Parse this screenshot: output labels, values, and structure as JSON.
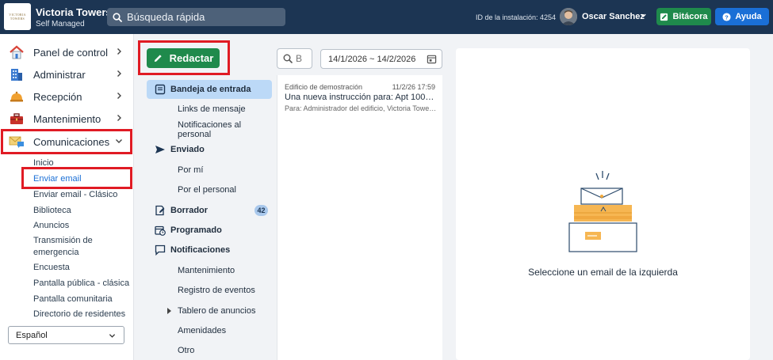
{
  "header": {
    "logo_text_1": "VICTORIA",
    "logo_text_2": "TOWERS",
    "building_name": "Victoria Towers",
    "building_subtitle": "Self Managed",
    "search_placeholder": "Búsqueda rápida",
    "installation_id": "ID de la instalación: 4254",
    "user_name": "Oscar Sanchez",
    "bitacora_label": "Bitácora",
    "help_label": "Ayuda"
  },
  "sidebar": {
    "items": [
      {
        "label": "Panel de control",
        "icon": "house-icon"
      },
      {
        "label": "Administrar",
        "icon": "building-icon"
      },
      {
        "label": "Recepción",
        "icon": "reception-bell-icon"
      },
      {
        "label": "Mantenimiento",
        "icon": "toolbox-icon"
      },
      {
        "label": "Comunicaciones",
        "icon": "envelope-chat-icon"
      }
    ],
    "sub_items": [
      "Inicio",
      "Enviar email",
      "Enviar email - Clásico",
      "Biblioteca",
      "Anuncios",
      "Transmisión de",
      "emergencia",
      "Encuesta",
      "Pantalla pública - clásica",
      "Pantalla comunitaria",
      "Directorio de residentes"
    ],
    "language": "Español"
  },
  "folders": {
    "compose_label": "Redactar",
    "inbox": "Bandeja de entrada",
    "message_links": "Links de mensaje",
    "staff_notifications": "Notificaciones al personal",
    "sent": "Enviado",
    "by_me": "Por mí",
    "by_staff": "Por el personal",
    "drafts": "Borrador",
    "drafts_count": "42",
    "scheduled": "Programado",
    "notifications": "Notificaciones",
    "maintenance": "Mantenimiento",
    "event_log": "Registro de eventos",
    "bulletin_board": "Tablero de anuncios",
    "amenities": "Amenidades",
    "other": "Otro"
  },
  "list": {
    "search_placeholder": "B",
    "date_range": "14/1/2026 ~ 14/2/2026",
    "messages": [
      {
        "from": "Edificio de demostración",
        "date": "11/2/26 17:59",
        "subject": "Una nueva instrucción para: Apt 1005 - ha...",
        "to": "Para: Administrador del edificio, Victoria Towers. ..."
      }
    ]
  },
  "reader": {
    "empty_message": "Seleccione un email de la izquierda"
  },
  "colors": {
    "topbar": "#1c3553",
    "green": "#1f8a4c",
    "blue": "#1a6fd6",
    "selected_folder": "#bcd9f7",
    "highlight": "#e01b24"
  }
}
